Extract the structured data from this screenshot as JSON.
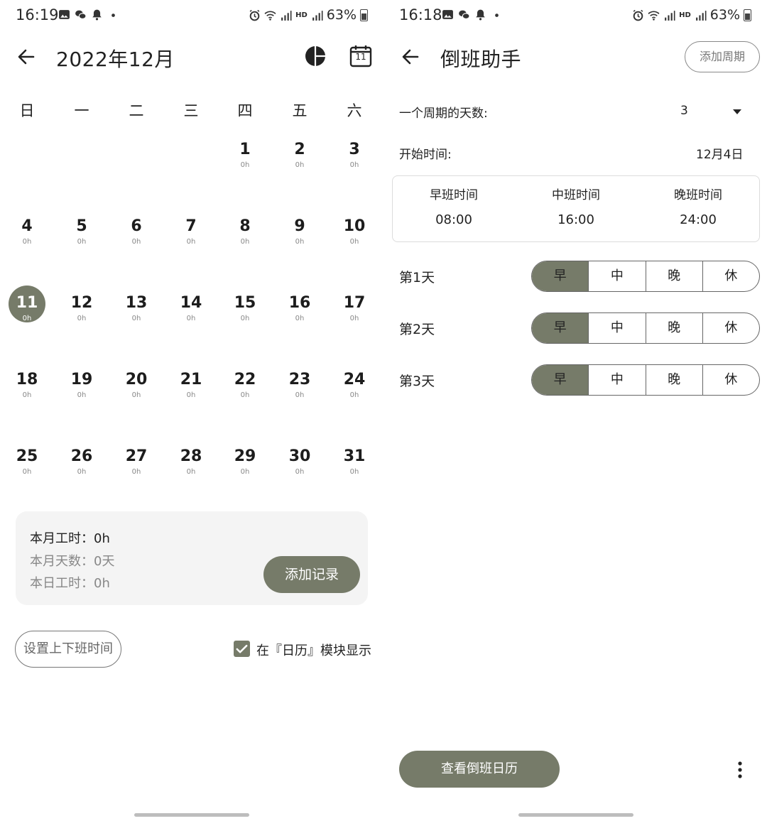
{
  "left_screen": {
    "status_bar": {
      "time": "16:19",
      "battery": "63%",
      "network": "HD"
    },
    "header": {
      "title": "2022年12月",
      "calendar_icon_day": "11"
    },
    "weekdays": [
      "日",
      "一",
      "二",
      "三",
      "四",
      "五",
      "六"
    ],
    "days": [
      {
        "num": "1",
        "hours": "0h"
      },
      {
        "num": "2",
        "hours": "0h"
      },
      {
        "num": "3",
        "hours": "0h"
      },
      {
        "num": "4",
        "hours": "0h"
      },
      {
        "num": "5",
        "hours": "0h"
      },
      {
        "num": "6",
        "hours": "0h"
      },
      {
        "num": "7",
        "hours": "0h"
      },
      {
        "num": "8",
        "hours": "0h"
      },
      {
        "num": "9",
        "hours": "0h"
      },
      {
        "num": "10",
        "hours": "0h"
      },
      {
        "num": "11",
        "hours": "0h"
      },
      {
        "num": "12",
        "hours": "0h"
      },
      {
        "num": "13",
        "hours": "0h"
      },
      {
        "num": "14",
        "hours": "0h"
      },
      {
        "num": "15",
        "hours": "0h"
      },
      {
        "num": "16",
        "hours": "0h"
      },
      {
        "num": "17",
        "hours": "0h"
      },
      {
        "num": "18",
        "hours": "0h"
      },
      {
        "num": "19",
        "hours": "0h"
      },
      {
        "num": "20",
        "hours": "0h"
      },
      {
        "num": "21",
        "hours": "0h"
      },
      {
        "num": "22",
        "hours": "0h"
      },
      {
        "num": "23",
        "hours": "0h"
      },
      {
        "num": "24",
        "hours": "0h"
      },
      {
        "num": "25",
        "hours": "0h"
      },
      {
        "num": "26",
        "hours": "0h"
      },
      {
        "num": "27",
        "hours": "0h"
      },
      {
        "num": "28",
        "hours": "0h"
      },
      {
        "num": "29",
        "hours": "0h"
      },
      {
        "num": "30",
        "hours": "0h"
      },
      {
        "num": "31",
        "hours": "0h"
      }
    ],
    "selected_day": "11",
    "summary": {
      "month_hours": "本月工时：0h",
      "month_days": "本月天数：0天",
      "today_hours": "本日工时：0h",
      "add_record": "添加记录"
    },
    "set_time_button": "设置上下班时间",
    "show_in_calendar": {
      "label": "在『日历』模块显示",
      "checked": true
    }
  },
  "right_screen": {
    "status_bar": {
      "time": "16:18",
      "battery": "63%",
      "network": "HD"
    },
    "header": {
      "title": "倒班助手",
      "add_cycle": "添加周期"
    },
    "cycle_days": {
      "label": "一个周期的天数:",
      "value": "3"
    },
    "start_time": {
      "label": "开始时间:",
      "value": "12月4日"
    },
    "shifts": [
      {
        "name": "早班时间",
        "time": "08:00"
      },
      {
        "name": "中班时间",
        "time": "16:00"
      },
      {
        "name": "晚班时间",
        "time": "24:00"
      }
    ],
    "shift_options": [
      "早",
      "中",
      "晚",
      "休"
    ],
    "day_rows": [
      {
        "label": "第1天",
        "selected": "早"
      },
      {
        "label": "第2天",
        "selected": "早"
      },
      {
        "label": "第3天",
        "selected": "早"
      }
    ],
    "view_calendar_button": "查看倒班日历"
  },
  "colors": {
    "accent": "#767b69",
    "card": "#f4f4f4",
    "text": "#222222"
  }
}
